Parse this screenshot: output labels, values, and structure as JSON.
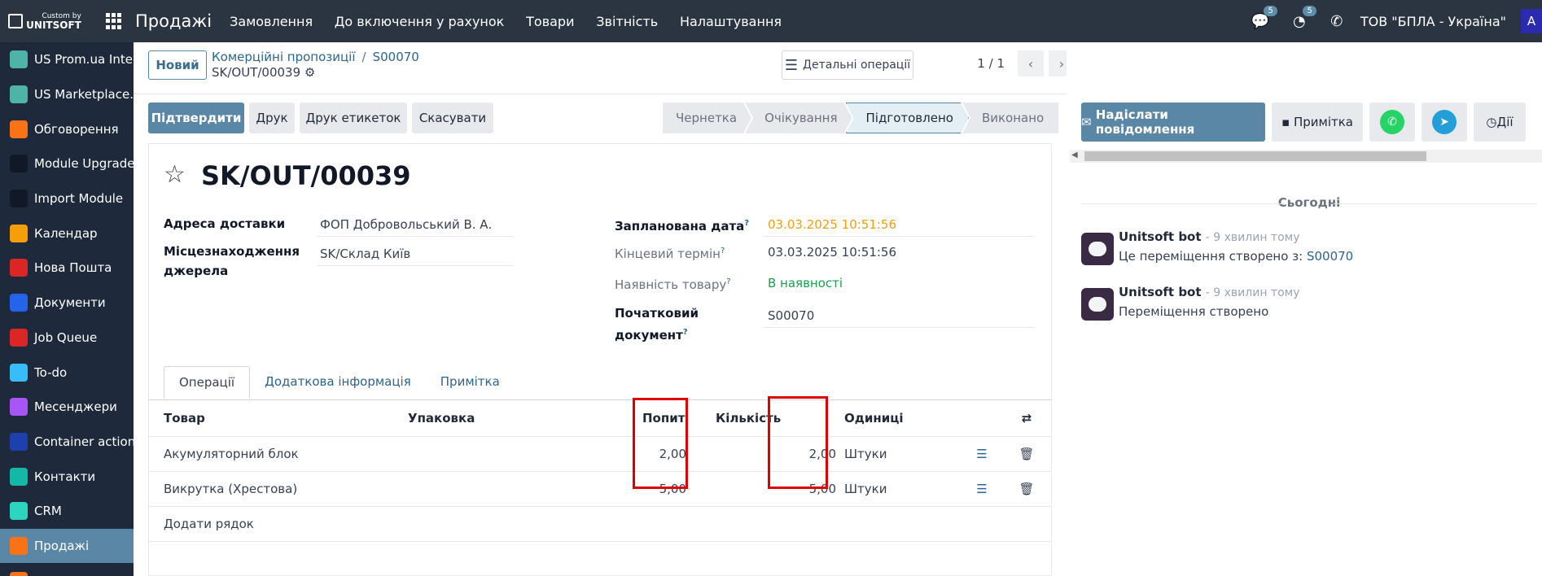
{
  "topbar": {
    "logo_top": "Custom by",
    "logo_bottom": "UNITSOFT",
    "app_name": "Продажі",
    "menu": [
      "Замовлення",
      "До включення у рахунок",
      "Товари",
      "Звітність",
      "Налаштування"
    ],
    "messages_count": "5",
    "activities_count": "5",
    "company": "ТОВ \"БПЛА - Україна\"",
    "avatar_letter": "A"
  },
  "sidebar": {
    "items": [
      {
        "label": "US Prom.ua Inte...",
        "icon": "cube-icon",
        "color": "#4fb3a9"
      },
      {
        "label": "US Marketplace...",
        "icon": "cube-icon",
        "color": "#4fb3a9"
      },
      {
        "label": "Обговорення",
        "icon": "chat-bubble-icon",
        "color": "#f97316"
      },
      {
        "label": "Module Upgrade",
        "icon": "upgrade-icon",
        "color": "#111827"
      },
      {
        "label": "Import Module",
        "icon": "import-icon",
        "color": "#111827"
      },
      {
        "label": "Календар",
        "icon": "calendar-icon",
        "color": "#f59e0b"
      },
      {
        "label": "Нова Пошта",
        "icon": "nova-poshta-icon",
        "color": "#dc2626"
      },
      {
        "label": "Документи",
        "icon": "documents-icon",
        "color": "#2563eb"
      },
      {
        "label": "Job Queue",
        "icon": "job-queue-icon",
        "color": "#dc2626"
      },
      {
        "label": "To-do",
        "icon": "todo-icon",
        "color": "#38bdf8"
      },
      {
        "label": "Месенджери",
        "icon": "messenger-icon",
        "color": "#a855f7"
      },
      {
        "label": "Container actions",
        "icon": "container-icon",
        "color": "#1e40af"
      },
      {
        "label": "Контакти",
        "icon": "contacts-icon",
        "color": "#14b8a6"
      },
      {
        "label": "CRM",
        "icon": "crm-icon",
        "color": "#2dd4bf"
      },
      {
        "label": "Продажі",
        "icon": "sales-icon",
        "color": "#f97316"
      },
      {
        "label": "",
        "icon": "more-icon",
        "color": "#f97316"
      }
    ],
    "active_index": 14
  },
  "control_panel": {
    "new_button": "Новий",
    "breadcrumb_parent": "Комерційні пропозиції",
    "breadcrumb_sep": "/",
    "breadcrumb_order": "S00070",
    "record_name": "SK/OUT/00039",
    "detail_ops": "Детальні операції",
    "pager": "1 / 1"
  },
  "actions": {
    "confirm": "Підтвердити",
    "print": "Друк",
    "print_labels": "Друк етикеток",
    "cancel": "Скасувати"
  },
  "statusbar": [
    "Чернетка",
    "Очікування",
    "Підготовлено",
    "Виконано"
  ],
  "statusbar_current": 2,
  "form": {
    "title": "SK/OUT/00039",
    "delivery_address_label": "Адреса доставки",
    "delivery_address": "ФОП Добровольський В. А.",
    "source_location_label_1": "Місцезнаходження",
    "source_location_label_2": "джерела",
    "source_location": "SK/Склад Київ",
    "scheduled_date_label": "Запланована дата",
    "scheduled_date": "03.03.2025 10:51:56",
    "scheduled_color": "#f59e0b",
    "deadline_label": "Кінцевий термін",
    "deadline": "03.03.2025 10:51:56",
    "availability_label": "Наявність товару",
    "availability": "В наявності",
    "availability_color": "#16a34a",
    "origin_label_1": "Початковий",
    "origin_label_2": "документ",
    "origin": "S00070",
    "help_mark": "?"
  },
  "tabs": [
    "Операції",
    "Додаткова інформація",
    "Примітка"
  ],
  "table": {
    "headers": {
      "product": "Товар",
      "packaging": "Упаковка",
      "demand": "Попит",
      "quantity": "Кількість",
      "uom": "Одиниці"
    },
    "rows": [
      {
        "product": "Акумуляторний блок",
        "demand": "2,00",
        "quantity": "2,00",
        "uom": "Штуки"
      },
      {
        "product": "Викрутка (Хрестова)",
        "demand": "5,00",
        "quantity": "5,00",
        "uom": "Штуки"
      }
    ],
    "add_line": "Додати рядок"
  },
  "chatter": {
    "send_message": "Надіслати повідомлення",
    "note": "Примітка",
    "activities": "Дії",
    "today": "Сьогодні",
    "messages": [
      {
        "author": "Unitsoft bot",
        "when": "- 9 хвилин тому",
        "text": "Це переміщення створено з: ",
        "link": "S00070"
      },
      {
        "author": "Unitsoft bot",
        "when": "- 9 хвилин тому",
        "text": "Переміщення створено",
        "link": ""
      }
    ]
  }
}
